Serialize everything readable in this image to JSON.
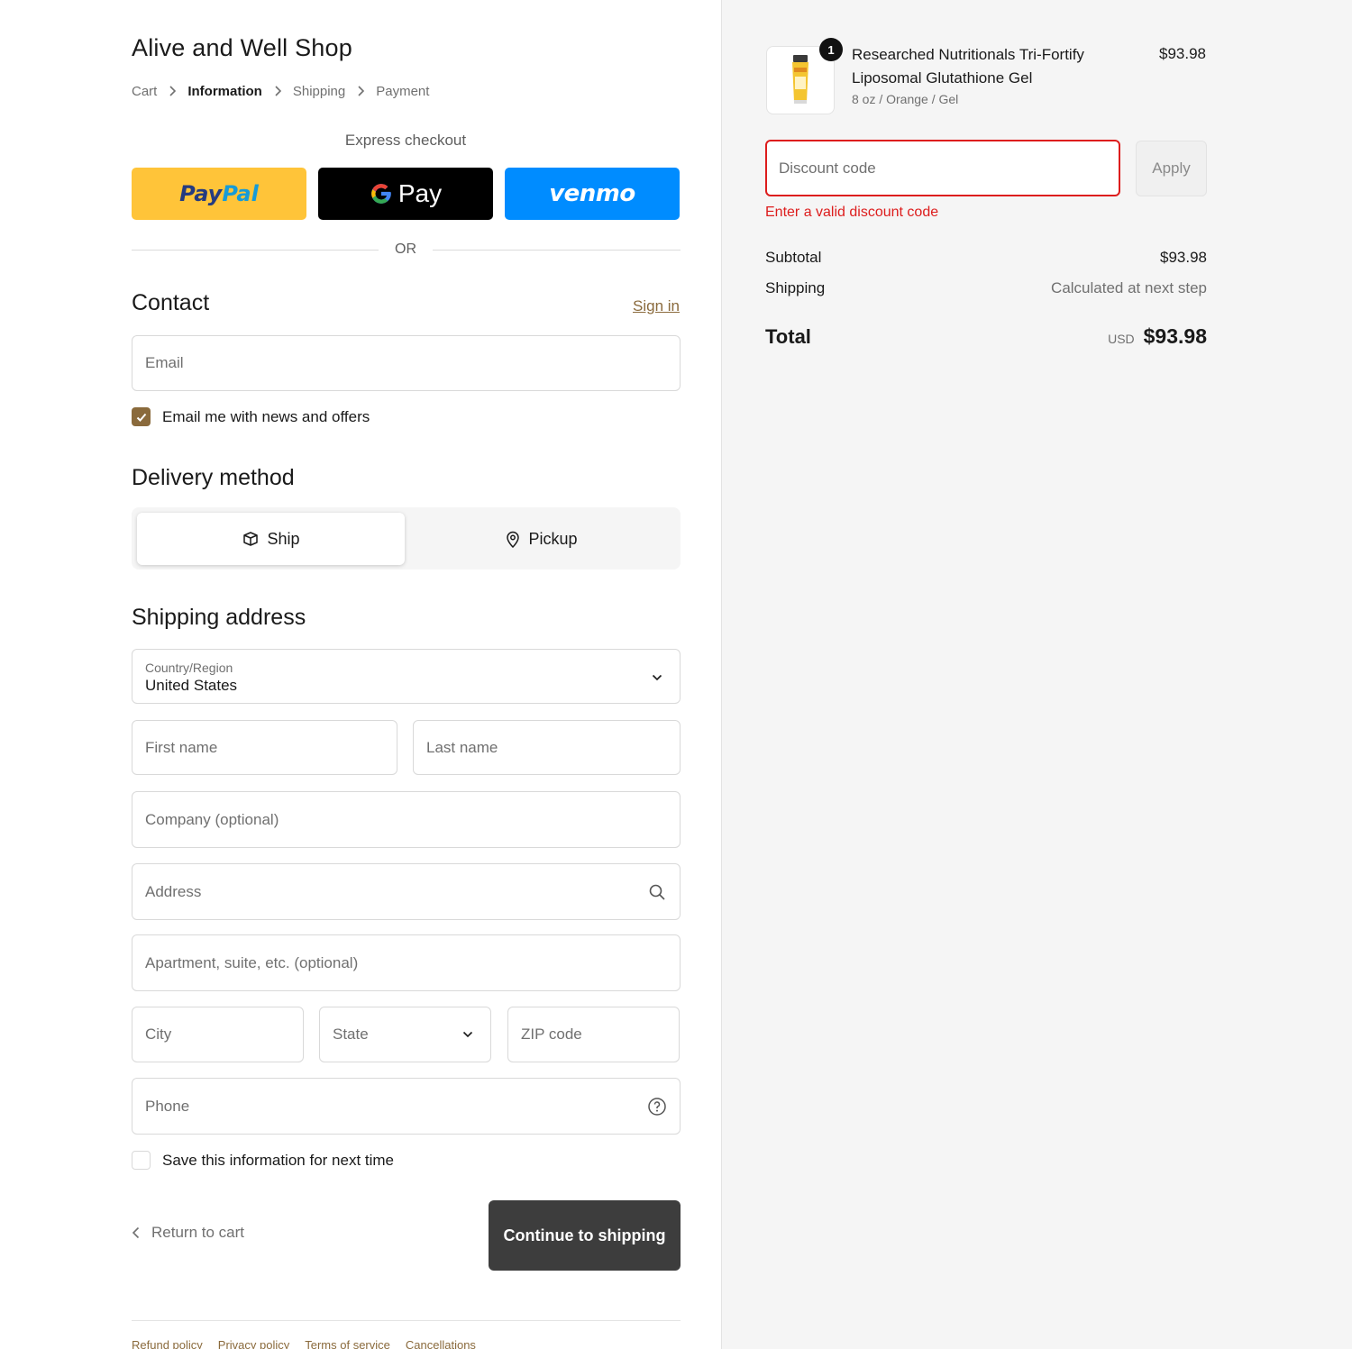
{
  "shop": {
    "title": "Alive and Well Shop"
  },
  "breadcrumb": [
    "Cart",
    "Information",
    "Shipping",
    "Payment"
  ],
  "express": {
    "label": "Express checkout",
    "paypal_a": "Pay",
    "paypal_b": "Pal",
    "gpay": "Pay",
    "venmo": "venmo",
    "or": "OR"
  },
  "contact": {
    "title": "Contact",
    "signin": "Sign in",
    "email_placeholder": "Email",
    "newsletter_label": "Email me with news and offers",
    "newsletter_checked": true
  },
  "delivery": {
    "title": "Delivery method",
    "ship": "Ship",
    "pickup": "Pickup",
    "selected": "Ship"
  },
  "shipping": {
    "title": "Shipping address",
    "country_label": "Country/Region",
    "country_value": "United States",
    "first_name": "First name",
    "last_name": "Last name",
    "company": "Company (optional)",
    "address": "Address",
    "apartment": "Apartment, suite, etc. (optional)",
    "city": "City",
    "state": "State",
    "zip": "ZIP code",
    "phone": "Phone",
    "save_info": "Save this information for next time",
    "save_info_checked": false
  },
  "actions": {
    "return": "Return to cart",
    "continue": "Continue to shipping"
  },
  "footer": [
    "Refund policy",
    "Privacy policy",
    "Terms of service",
    "Cancellations"
  ],
  "order": {
    "item": {
      "quantity": "1",
      "name": "Researched Nutritionals Tri-Fortify Liposomal Glutathione Gel",
      "variant": "8 oz / Orange / Gel",
      "price": "$93.98"
    },
    "discount_placeholder": "Discount code",
    "apply": "Apply",
    "discount_error": "Enter a valid discount code",
    "subtotal_label": "Subtotal",
    "subtotal": "$93.98",
    "shipping_label": "Shipping",
    "shipping_value": "Calculated at next step",
    "total_label": "Total",
    "currency": "USD",
    "total": "$93.98"
  },
  "colors": {
    "accent": "#8a6a3c",
    "error": "#dd1d1d",
    "paypal": "#ffc439",
    "venmo": "#008cff",
    "continue_button": "#3d3d3d"
  }
}
